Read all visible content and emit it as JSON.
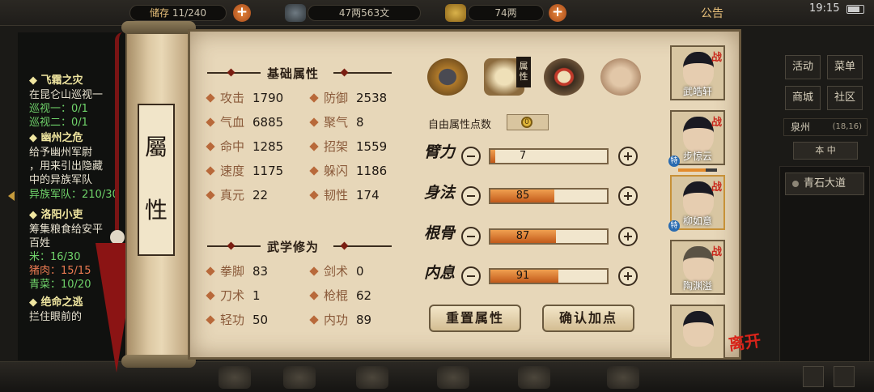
{
  "top_bar": {
    "storage": "11/240",
    "storage_partial_label": "储存",
    "copper": "47两563文",
    "silver": "74两",
    "announcement": "公告",
    "time": "19:15"
  },
  "quests": [
    {
      "text": "◆ 飞霜之灾",
      "kind": "header"
    },
    {
      "text": "在昆仑山巡视一",
      "kind": "text"
    },
    {
      "text": "巡视一：0/1",
      "kind": "progress"
    },
    {
      "text": "巡视二：0/1",
      "kind": "progress"
    },
    {
      "text": "◆ 幽州之危",
      "kind": "header"
    },
    {
      "text": "给予幽州军尉",
      "kind": "text"
    },
    {
      "text": "，用来引出隐藏",
      "kind": "text"
    },
    {
      "text": "中的异族军队",
      "kind": "text"
    },
    {
      "text": "异族军队：210/30",
      "kind": "progress"
    },
    {
      "text": "◆ 洛阳小吏",
      "kind": "header"
    },
    {
      "text": "筹集粮食给安平",
      "kind": "text"
    },
    {
      "text": "百姓",
      "kind": "text"
    },
    {
      "text": "米：16/30",
      "kind": "progress"
    },
    {
      "text": "猪肉：15/15",
      "kind": "done"
    },
    {
      "text": "青菜：10/20",
      "kind": "progress"
    },
    {
      "text": "◆ 绝命之逃",
      "kind": "header"
    },
    {
      "text": "拦住眼前的",
      "kind": "text"
    }
  ],
  "right_menu": {
    "buttons": [
      "活动",
      "菜单",
      "商城",
      "社区"
    ],
    "location": "泉州",
    "location_coords": "(18,16)",
    "map_select": "本 中",
    "road": "青石大道"
  },
  "scroll": {
    "chars": [
      "屬",
      "性"
    ]
  },
  "sections": {
    "basic_title": "基础属性",
    "martial_title": "武学修为"
  },
  "basic_stats": [
    {
      "label": "攻击",
      "value": "1790"
    },
    {
      "label": "防御",
      "value": "2538"
    },
    {
      "label": "气血",
      "value": "6885"
    },
    {
      "label": "聚气",
      "value": "8"
    },
    {
      "label": "命中",
      "value": "1285"
    },
    {
      "label": "招架",
      "value": "1559"
    },
    {
      "label": "速度",
      "value": "1175"
    },
    {
      "label": "躲闪",
      "value": "1186"
    },
    {
      "label": "真元",
      "value": "22"
    },
    {
      "label": "韧性",
      "value": "174"
    }
  ],
  "martial_stats": [
    {
      "label": "拳脚",
      "value": "83"
    },
    {
      "label": "剑术",
      "value": "0"
    },
    {
      "label": "刀术",
      "value": "1"
    },
    {
      "label": "枪棍",
      "value": "62"
    },
    {
      "label": "轻功",
      "value": "50"
    },
    {
      "label": "内功",
      "value": "89"
    }
  ],
  "category_tab_label": "属性",
  "category_icons": [
    "straw-hat-icon",
    "scroll-map-icon",
    "bagua-icon",
    "meridian-body-icon"
  ],
  "free_points": {
    "label": "自由属性点数",
    "value": "0"
  },
  "attributes": [
    {
      "name": "臂力",
      "value": "7",
      "fill": 0.04
    },
    {
      "name": "身法",
      "value": "85",
      "fill": 0.55
    },
    {
      "name": "根骨",
      "value": "87",
      "fill": 0.56
    },
    {
      "name": "内息",
      "value": "91",
      "fill": 0.58
    }
  ],
  "buttons": {
    "reset": "重置属性",
    "confirm": "确认加点"
  },
  "party": [
    {
      "name": "武皓轩",
      "tag": "战"
    },
    {
      "name": "步惊云",
      "tag": "战",
      "badge": "特"
    },
    {
      "name": "柳如意",
      "tag": "战",
      "badge": "特"
    },
    {
      "name": "陶渊溢",
      "tag": "战"
    },
    {
      "name": "",
      "tag": ""
    }
  ],
  "leave": "离开",
  "colors": {
    "accent": "#c25a1a",
    "paper": "#e7d7b9",
    "tassel": "#8b1414"
  }
}
